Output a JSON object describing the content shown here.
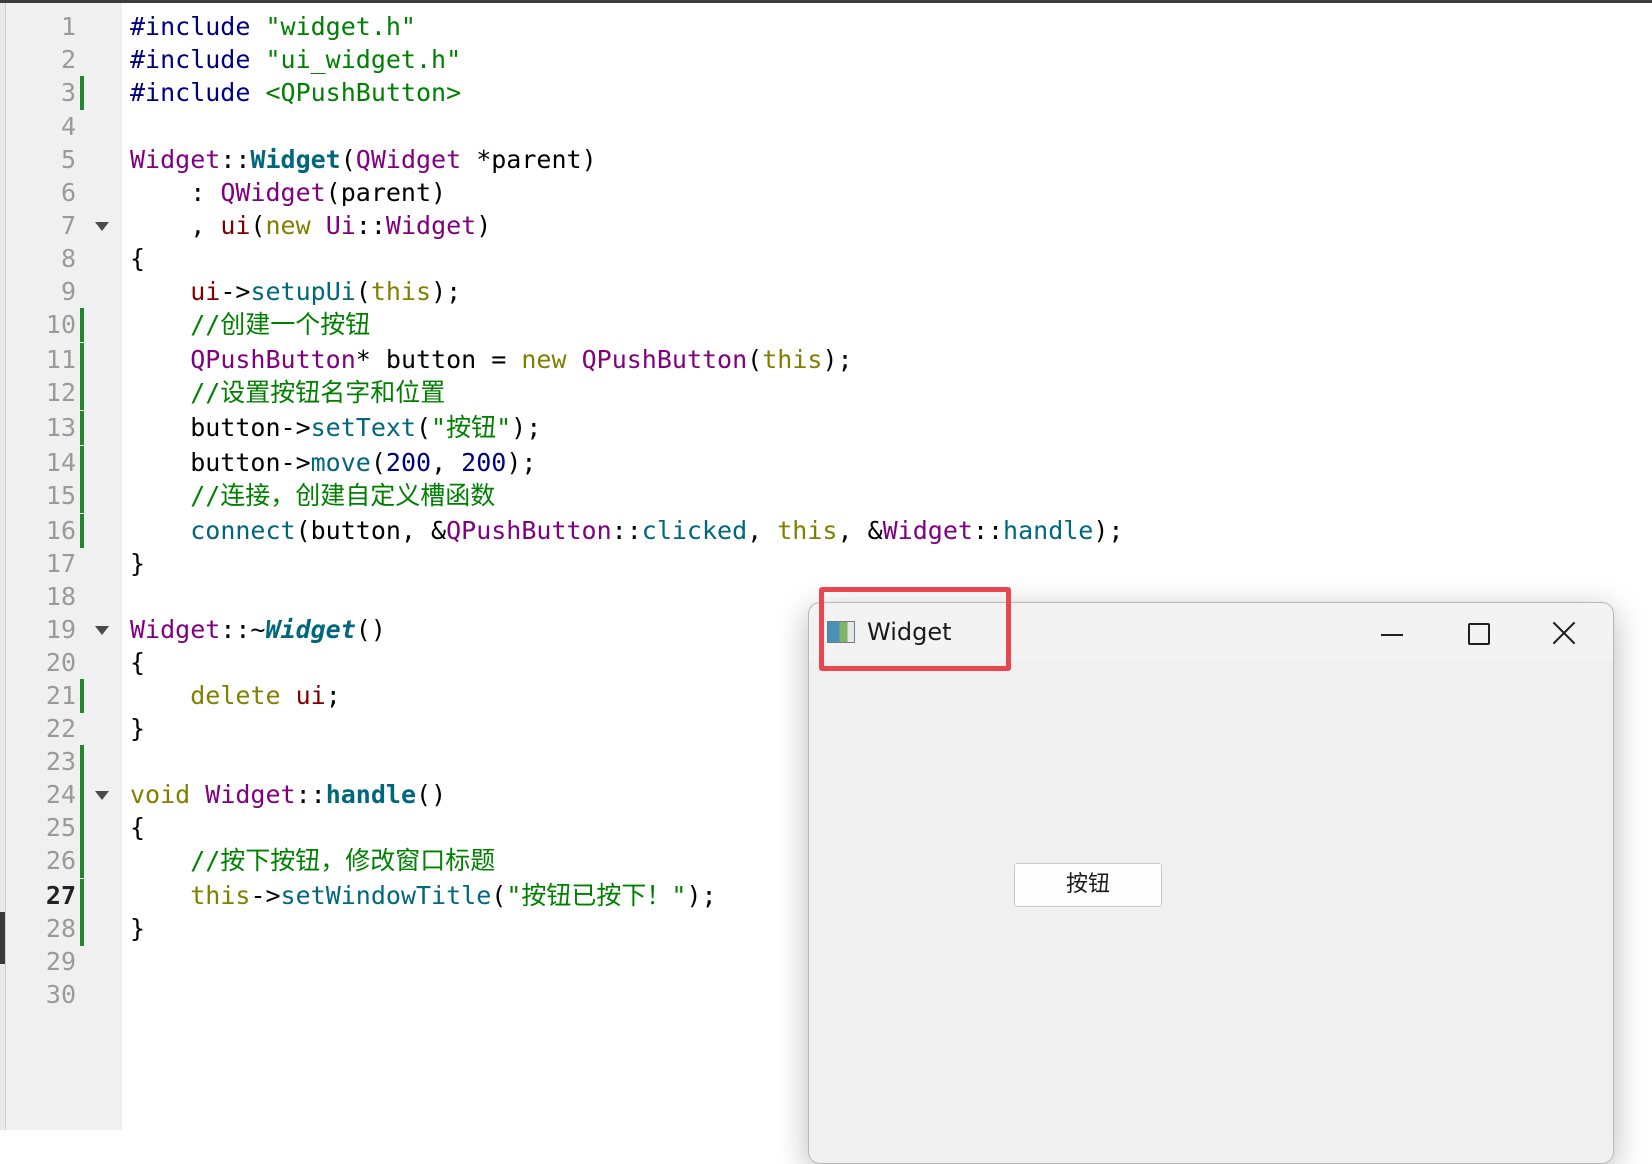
{
  "editor": {
    "lines": [
      {
        "num": "1",
        "segs": [
          [
            "pp",
            "#include "
          ],
          [
            "st",
            "\"widget.h\""
          ]
        ]
      },
      {
        "num": "2",
        "segs": [
          [
            "pp",
            "#include "
          ],
          [
            "st",
            "\"ui_widget.h\""
          ]
        ]
      },
      {
        "num": "3",
        "segs": [
          [
            "pp",
            "#include "
          ],
          [
            "st",
            "<QPushButton>"
          ]
        ]
      },
      {
        "num": "4",
        "segs": []
      },
      {
        "num": "5",
        "segs": [
          [
            "cl",
            "Widget"
          ],
          [
            "",
            "::"
          ],
          [
            "fnb",
            "Widget"
          ],
          [
            "",
            "("
          ],
          [
            "cl",
            "QWidget"
          ],
          [
            "",
            " *parent)"
          ]
        ]
      },
      {
        "num": "6",
        "segs": [
          [
            "",
            "    : "
          ],
          [
            "cl",
            "QWidget"
          ],
          [
            "",
            "(parent)"
          ]
        ]
      },
      {
        "num": "7",
        "segs": [
          [
            "",
            "    , "
          ],
          [
            "mb",
            "ui"
          ],
          [
            "",
            "("
          ],
          [
            "kw",
            "new"
          ],
          [
            "",
            " "
          ],
          [
            "cl",
            "Ui"
          ],
          [
            "",
            "::"
          ],
          [
            "cl",
            "Widget"
          ],
          [
            "",
            ")"
          ]
        ]
      },
      {
        "num": "8",
        "segs": [
          [
            "",
            "{"
          ]
        ]
      },
      {
        "num": "9",
        "segs": [
          [
            "",
            "    "
          ],
          [
            "mb",
            "ui"
          ],
          [
            "",
            "->"
          ],
          [
            "fn",
            "setupUi"
          ],
          [
            "",
            "("
          ],
          [
            "kw",
            "this"
          ],
          [
            "",
            ");"
          ]
        ]
      },
      {
        "num": "10",
        "segs": [
          [
            "cm",
            "    //创建一个按钮"
          ]
        ]
      },
      {
        "num": "11",
        "segs": [
          [
            "",
            "    "
          ],
          [
            "cl",
            "QPushButton"
          ],
          [
            "",
            "* button = "
          ],
          [
            "kw",
            "new"
          ],
          [
            "",
            " "
          ],
          [
            "cl",
            "QPushButton"
          ],
          [
            "",
            "("
          ],
          [
            "kw",
            "this"
          ],
          [
            "",
            ");"
          ]
        ]
      },
      {
        "num": "12",
        "segs": [
          [
            "cm",
            "    //设置按钮名字和位置"
          ]
        ]
      },
      {
        "num": "13",
        "segs": [
          [
            "",
            "    button->"
          ],
          [
            "fn",
            "setText"
          ],
          [
            "",
            "("
          ],
          [
            "st",
            "\"按钮\""
          ],
          [
            "",
            ");"
          ]
        ]
      },
      {
        "num": "14",
        "segs": [
          [
            "",
            "    button->"
          ],
          [
            "fn",
            "move"
          ],
          [
            "",
            "("
          ],
          [
            "nm",
            "200"
          ],
          [
            "",
            ", "
          ],
          [
            "nm",
            "200"
          ],
          [
            "",
            ");"
          ]
        ]
      },
      {
        "num": "15",
        "segs": [
          [
            "cm",
            "    //连接，创建自定义槽函数"
          ]
        ]
      },
      {
        "num": "16",
        "segs": [
          [
            "",
            "    "
          ],
          [
            "fn",
            "connect"
          ],
          [
            "",
            "(button, &"
          ],
          [
            "cl",
            "QPushButton"
          ],
          [
            "",
            "::"
          ],
          [
            "fn",
            "clicked"
          ],
          [
            "",
            ", "
          ],
          [
            "kw",
            "this"
          ],
          [
            "",
            ", &"
          ],
          [
            "cl",
            "Widget"
          ],
          [
            "",
            "::"
          ],
          [
            "fn",
            "handle"
          ],
          [
            "",
            ");"
          ]
        ]
      },
      {
        "num": "17",
        "segs": [
          [
            "",
            "}"
          ]
        ]
      },
      {
        "num": "18",
        "segs": []
      },
      {
        "num": "19",
        "segs": [
          [
            "cl",
            "Widget"
          ],
          [
            "",
            "::~"
          ],
          [
            "fnbi",
            "Widget"
          ],
          [
            "",
            "()"
          ]
        ]
      },
      {
        "num": "20",
        "segs": [
          [
            "",
            "{"
          ]
        ]
      },
      {
        "num": "21",
        "segs": [
          [
            "",
            "    "
          ],
          [
            "kw",
            "delete"
          ],
          [
            "",
            " "
          ],
          [
            "mb",
            "ui"
          ],
          [
            "",
            ";"
          ]
        ]
      },
      {
        "num": "22",
        "segs": [
          [
            "",
            "}"
          ]
        ]
      },
      {
        "num": "23",
        "segs": []
      },
      {
        "num": "24",
        "segs": [
          [
            "kw",
            "void"
          ],
          [
            "",
            " "
          ],
          [
            "cl",
            "Widget"
          ],
          [
            "",
            "::"
          ],
          [
            "fnb",
            "handle"
          ],
          [
            "",
            "()"
          ]
        ]
      },
      {
        "num": "25",
        "segs": [
          [
            "",
            "{"
          ]
        ]
      },
      {
        "num": "26",
        "segs": [
          [
            "cm",
            "    //按下按钮，修改窗口标题"
          ]
        ]
      },
      {
        "num": "27",
        "segs": [
          [
            "",
            "    "
          ],
          [
            "kw",
            "this"
          ],
          [
            "",
            "->"
          ],
          [
            "fn",
            "setWindowTitle"
          ],
          [
            "",
            "("
          ],
          [
            "st",
            "\"按钮已按下！\""
          ],
          [
            "",
            ");"
          ]
        ]
      },
      {
        "num": "28",
        "segs": [
          [
            "",
            "}"
          ]
        ]
      },
      {
        "num": "29",
        "segs": []
      },
      {
        "num": "30",
        "segs": []
      }
    ],
    "current_line": "27"
  },
  "window": {
    "title": "Widget",
    "button_label": "按钮"
  },
  "colors": {
    "highlight_box": "#e8474f",
    "change_marker": "#22862e"
  }
}
